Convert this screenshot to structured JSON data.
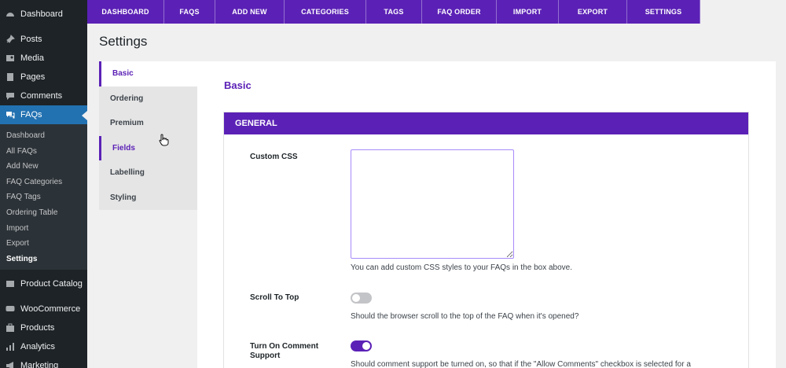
{
  "sidebar": {
    "items": [
      {
        "label": "Dashboard",
        "icon": "dashboard-icon"
      },
      {
        "label": "Posts",
        "icon": "pin-icon"
      },
      {
        "label": "Media",
        "icon": "media-icon"
      },
      {
        "label": "Pages",
        "icon": "pages-icon"
      },
      {
        "label": "Comments",
        "icon": "comments-icon"
      },
      {
        "label": "FAQs",
        "icon": "faqs-icon"
      }
    ],
    "faq_submenu": [
      {
        "label": "Dashboard"
      },
      {
        "label": "All FAQs"
      },
      {
        "label": "Add New"
      },
      {
        "label": "FAQ Categories"
      },
      {
        "label": "FAQ Tags"
      },
      {
        "label": "Ordering Table"
      },
      {
        "label": "Import"
      },
      {
        "label": "Export"
      },
      {
        "label": "Settings"
      }
    ],
    "lower_items": [
      {
        "label": "Product Catalog",
        "icon": "catalog-icon"
      },
      {
        "label": "WooCommerce",
        "icon": "woocommerce-icon"
      },
      {
        "label": "Products",
        "icon": "products-icon"
      },
      {
        "label": "Analytics",
        "icon": "analytics-icon"
      },
      {
        "label": "Marketing",
        "icon": "marketing-icon"
      }
    ]
  },
  "topnav": {
    "tabs": [
      {
        "label": "DASHBOARD"
      },
      {
        "label": "FAQS"
      },
      {
        "label": "ADD NEW"
      },
      {
        "label": "CATEGORIES"
      },
      {
        "label": "TAGS"
      },
      {
        "label": "FAQ ORDER"
      },
      {
        "label": "IMPORT"
      },
      {
        "label": "EXPORT"
      },
      {
        "label": "SETTINGS"
      }
    ]
  },
  "page": {
    "title": "Settings"
  },
  "settings_tabs": [
    {
      "label": "Basic"
    },
    {
      "label": "Ordering"
    },
    {
      "label": "Premium"
    },
    {
      "label": "Fields"
    },
    {
      "label": "Labelling"
    },
    {
      "label": "Styling"
    }
  ],
  "content": {
    "heading": "Basic",
    "section_title": "GENERAL",
    "fields": {
      "custom_css": {
        "label": "Custom CSS",
        "value": "",
        "description": "You can add custom CSS styles to your FAQs in the box above."
      },
      "scroll_to_top": {
        "label": "Scroll To Top",
        "enabled": false,
        "description": "Should the browser scroll to the top of the FAQ when it's opened?"
      },
      "comment_support": {
        "label": "Turn On Comment Support",
        "enabled": true,
        "description": "Should comment support be turned on, so that if the \"Allow Comments\" checkbox is selected for a"
      }
    }
  },
  "colors": {
    "accent": "#5b21b6",
    "sidebar_bg": "#1d2327",
    "sidebar_active": "#2271b1"
  }
}
